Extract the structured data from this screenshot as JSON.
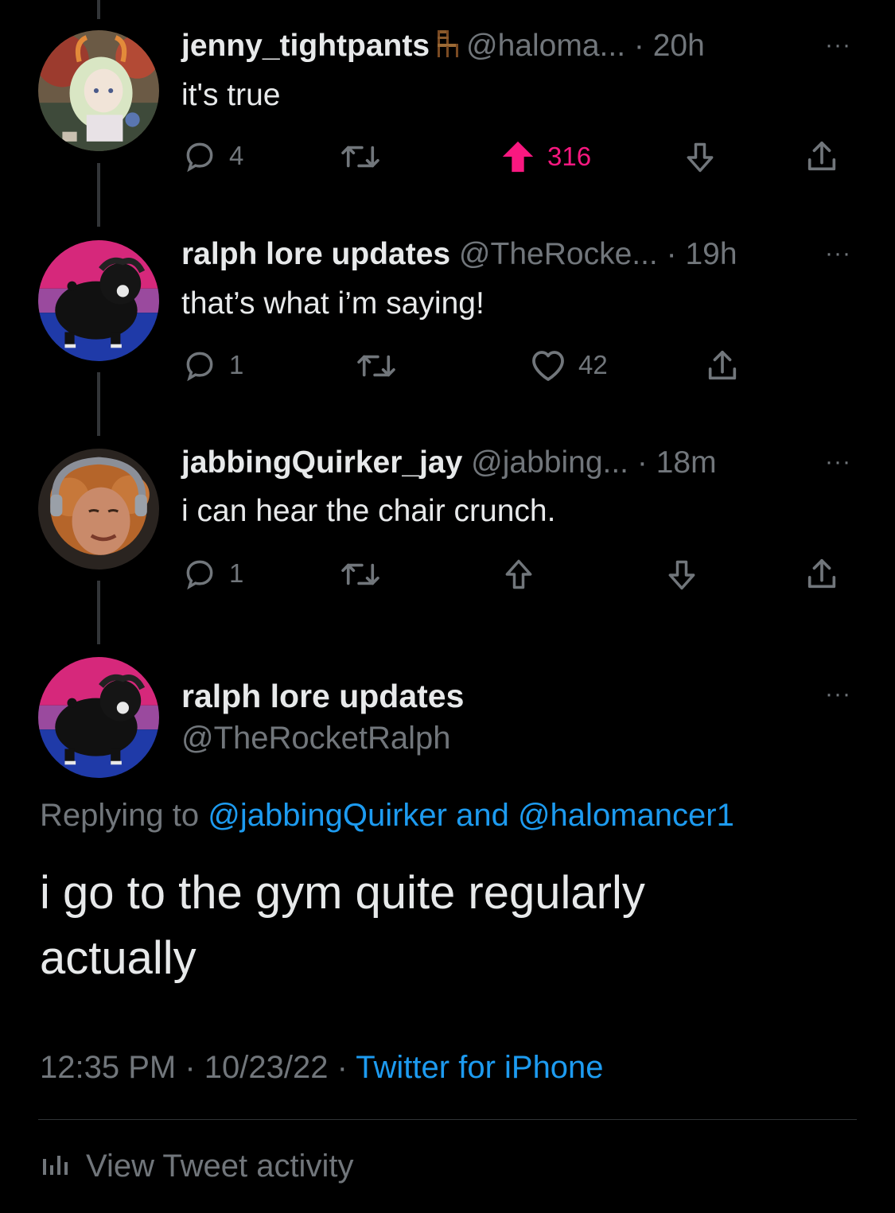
{
  "tweets": [
    {
      "name": "jenny_tightpants",
      "handle": "@haloma...",
      "sep": "·",
      "time": "20h",
      "text": "it's true",
      "replies": "4",
      "score": "316",
      "more": "···"
    },
    {
      "name": "ralph lore updates",
      "handle": "@TheRocke...",
      "sep": "·",
      "time": "19h",
      "text": "that’s what i’m saying!",
      "replies": "1",
      "likes": "42",
      "more": "···"
    },
    {
      "name": "jabbingQuirker_jay",
      "handle": "@jabbing...",
      "sep": "·",
      "time": "18m",
      "text": "i can hear the chair crunch.",
      "replies": "1",
      "more": "···"
    }
  ],
  "main": {
    "name": "ralph lore updates",
    "handle": "@TheRocketRalph",
    "more": "···",
    "replying_prefix": "Replying to ",
    "mention1": "@jabbingQuirker",
    "and": " and ",
    "mention2": "@halomancer1",
    "text_line1": "i go to the gym quite regularly",
    "text_line2": "actually",
    "time": "12:35 PM",
    "dot": " · ",
    "date": "10/23/22",
    "client": "Twitter for iPhone",
    "activity_label": "View Tweet activity"
  },
  "colors": {
    "background": "#000000",
    "text": "#e7e9ea",
    "muted": "#71767b",
    "link": "#1d9bf0",
    "upvote": "#f91880"
  },
  "icons": [
    "chair-icon",
    "reply-icon",
    "retweet-icon",
    "upvote-icon",
    "downvote-icon",
    "like-icon",
    "share-icon",
    "analytics-icon"
  ]
}
